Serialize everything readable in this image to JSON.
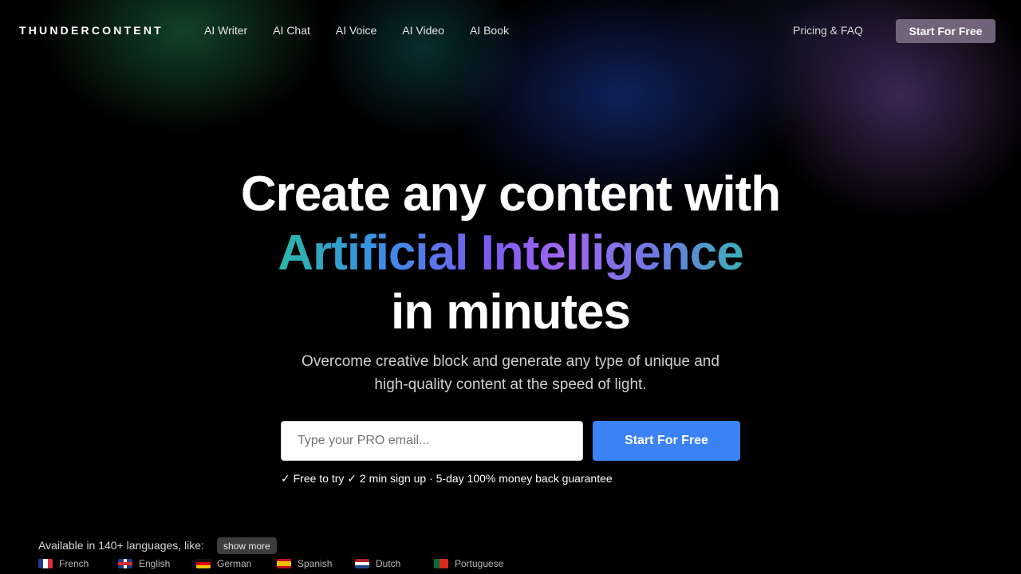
{
  "header": {
    "logo": "THUNDERCONTENT",
    "nav": [
      "AI Writer",
      "AI Chat",
      "AI Voice",
      "AI Video",
      "AI Book"
    ],
    "pricing": "Pricing & FAQ",
    "cta": "Start For Free"
  },
  "hero": {
    "line1": "Create any content with",
    "line2": "Artificial Intelligence",
    "line3": "in minutes",
    "sub1": "Overcome creative block and generate any type of unique and",
    "sub2": "high-quality content at the speed of light.",
    "email_placeholder": "Type your PRO email...",
    "cta": "Start For Free",
    "perks": "✓ Free to try ✓ 2 min sign up · 5-day 100% money back guarantee"
  },
  "languages": {
    "heading": "Available in 140+ languages, like:",
    "show_more": "show more",
    "items": [
      {
        "name": "French",
        "flag": "flag-fr"
      },
      {
        "name": "English",
        "flag": "flag-gb"
      },
      {
        "name": "German",
        "flag": "flag-de"
      },
      {
        "name": "Spanish",
        "flag": "flag-es"
      },
      {
        "name": "Dutch",
        "flag": "flag-nl"
      },
      {
        "name": "Portuguese",
        "flag": "flag-pt"
      }
    ]
  },
  "colors": {
    "cta_blue": "#3b82f6",
    "nav_cta": "#6f6479"
  }
}
